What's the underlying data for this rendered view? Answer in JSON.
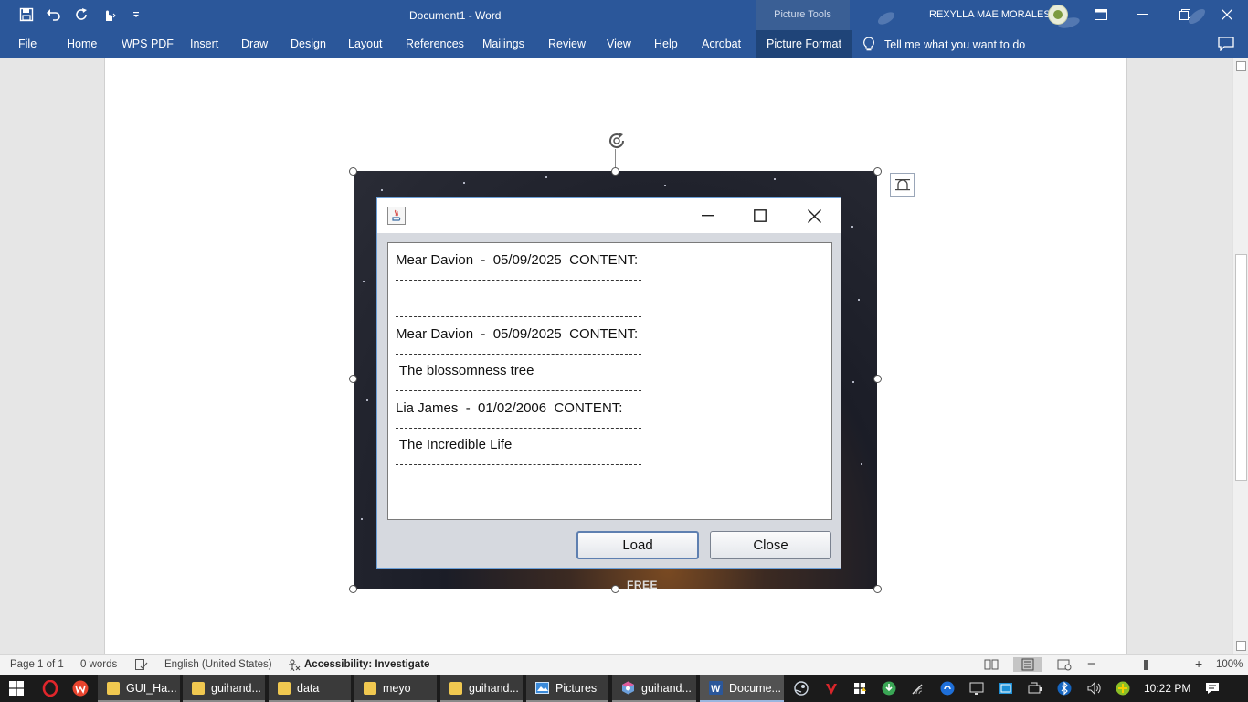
{
  "titlebar": {
    "document_title": "Document1  -  Word",
    "context_tab": "Picture Tools",
    "user_name": "REXYLLA MAE MORALES"
  },
  "ribbon": {
    "tabs": [
      "File",
      "Home",
      "WPS PDF",
      "Insert",
      "Draw",
      "Design",
      "Layout",
      "References",
      "Mailings",
      "Review",
      "View",
      "Help",
      "Acrobat",
      "Picture Format"
    ],
    "active_tab": "Picture Format",
    "tell_me": "Tell me what you want to do"
  },
  "dialog": {
    "lines": [
      "Mear Davion  -  05/09/2025  CONTENT:",
      "",
      "Mear Davion  -  05/09/2025  CONTENT:",
      " The blossomness tree",
      "Lia James  -  01/02/2006  CONTENT:",
      " The Incredible Life"
    ],
    "load_label": "Load",
    "close_label": "Close"
  },
  "picture": {
    "caption_text": "FREE"
  },
  "statusbar": {
    "page": "Page 1 of 1",
    "words": "0 words",
    "language": "English (United States)",
    "accessibility": "Accessibility: Investigate",
    "zoom": "100%"
  },
  "taskbar": {
    "apps": [
      "GUI_Ha...",
      "guihand...",
      "data",
      "meyo",
      "guihand...",
      "Pictures",
      "guihand...",
      "Docume..."
    ],
    "clock": "10:22 PM"
  },
  "colors": {
    "word_blue": "#2b579a",
    "taskbar": "#1b1b1b",
    "dialog_bg": "#d6d9df"
  }
}
